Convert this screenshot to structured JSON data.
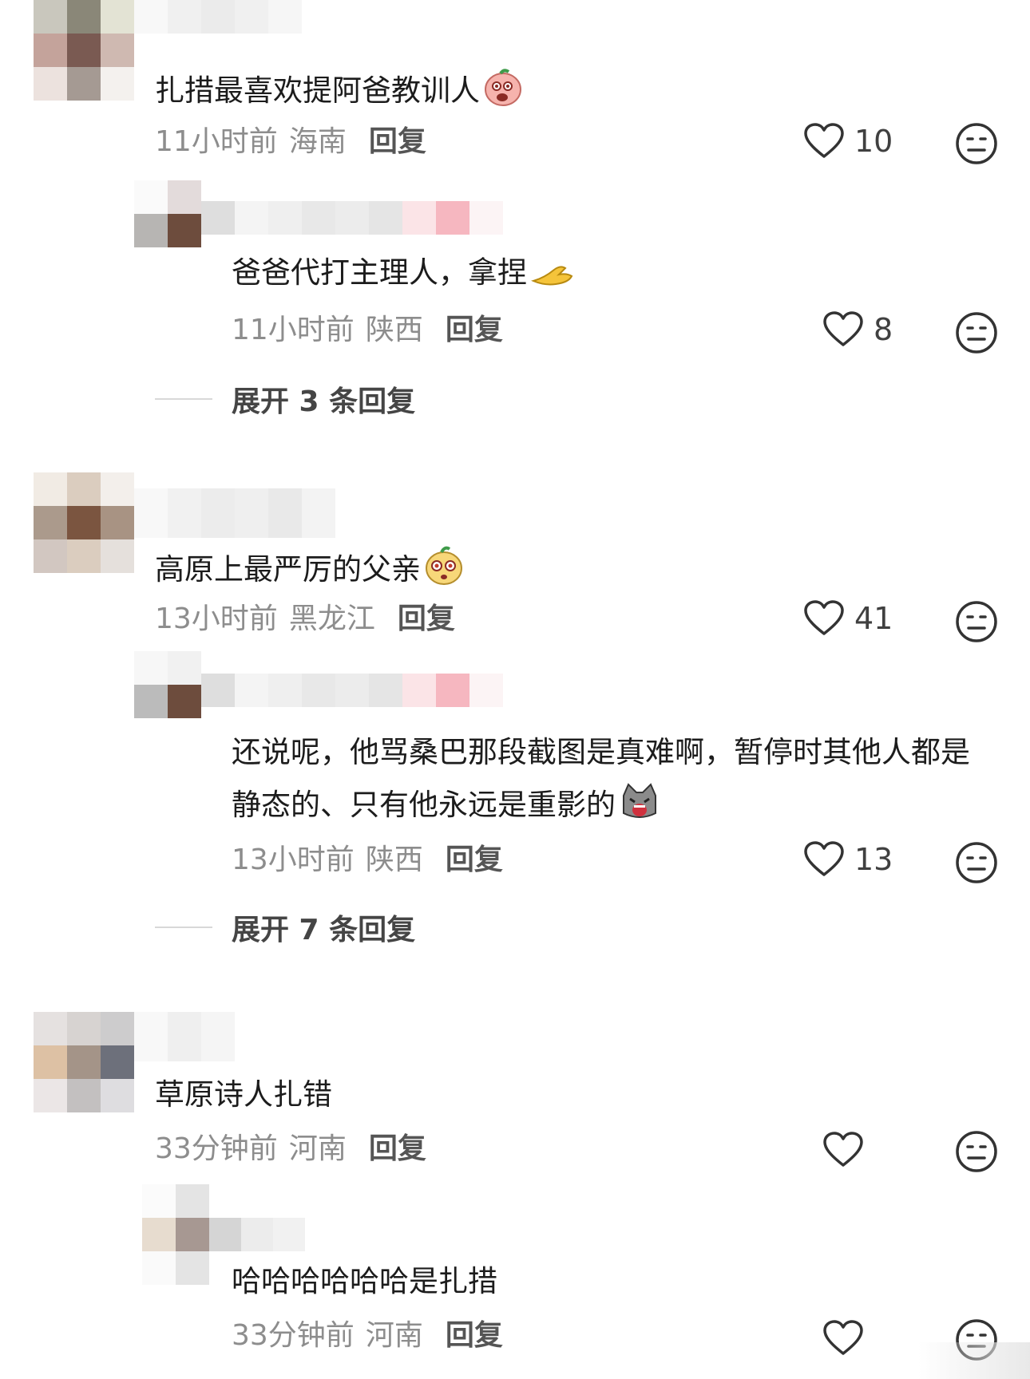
{
  "comments": [
    {
      "text": "扎措最喜欢提阿爸教训人",
      "time": "11小时前",
      "region": "海南",
      "reply_label": "回复",
      "likes": "10",
      "emoji": "peach-face-emoji"
    },
    {
      "text": "爸爸代打主理人，拿捏",
      "time": "11小时前",
      "region": "陕西",
      "reply_label": "回复",
      "likes": "8",
      "emoji": "pinch-hand-emoji"
    },
    {
      "text": "高原上最严厉的父亲",
      "time": "13小时前",
      "region": "黑龙江",
      "reply_label": "回复",
      "likes": "41",
      "emoji": "surprised-face-emoji"
    },
    {
      "text": "还说呢，他骂桑巴那段截图是真难啊，暂停时其他人都是静态的、只有他永远是重影的",
      "time": "13小时前",
      "region": "陕西",
      "reply_label": "回复",
      "likes": "13",
      "emoji": "crying-cat-emoji"
    },
    {
      "text": "草原诗人扎错",
      "time": "33分钟前",
      "region": "河南",
      "reply_label": "回复",
      "likes": ""
    },
    {
      "text": "哈哈哈哈哈哈是扎措",
      "time": "33分钟前",
      "region": "河南",
      "reply_label": "回复",
      "likes": ""
    }
  ],
  "expanders": [
    {
      "label": "展开 3 条回复"
    },
    {
      "label": "展开 7 条回复"
    }
  ],
  "icons": {
    "like": "heart-outline-icon",
    "dislike": "neutral-face-icon"
  },
  "colors": {
    "meta_text": "#8d8d8d",
    "icon_stroke": "#333333"
  }
}
